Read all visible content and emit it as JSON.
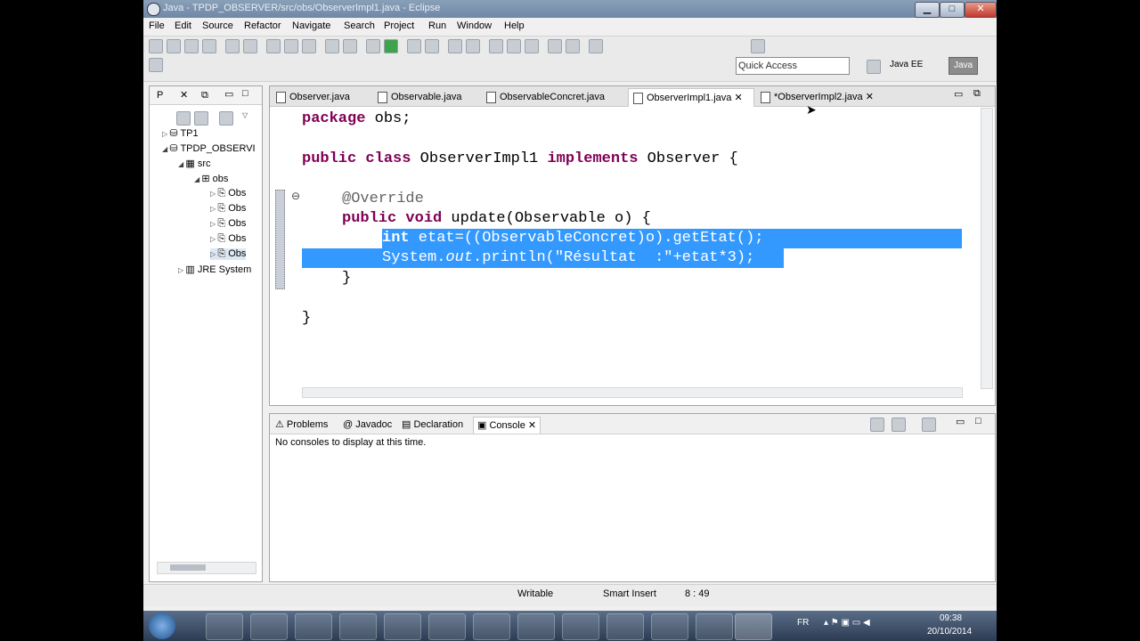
{
  "window": {
    "title": "Java - TPDP_OBSERVER/src/obs/ObserverImpl1.java - Eclipse",
    "controls": {
      "minimize": "▁",
      "maximize": "□",
      "close": "✕"
    }
  },
  "menu": [
    "File",
    "Edit",
    "Source",
    "Refactor",
    "Navigate",
    "Search",
    "Project",
    "Run",
    "Window",
    "Help"
  ],
  "quick_access": {
    "placeholder": "Quick Access"
  },
  "perspectives": [
    "Java EE",
    "Java"
  ],
  "package_explorer": {
    "tabs": [
      "P",
      "⧉"
    ],
    "tree": [
      {
        "label": "TP1"
      },
      {
        "label": "TPDP_OBSERVI"
      },
      {
        "label": "src"
      },
      {
        "label": "obs"
      },
      {
        "label": "Obs"
      },
      {
        "label": "Obs"
      },
      {
        "label": "Obs"
      },
      {
        "label": "Obs"
      },
      {
        "label": "Obs"
      },
      {
        "label": "JRE System"
      }
    ]
  },
  "editor": {
    "tabs": [
      {
        "label": "Observer.java",
        "active": false
      },
      {
        "label": "Observable.java",
        "active": false
      },
      {
        "label": "ObservableConcret.java",
        "active": false
      },
      {
        "label": "ObserverImpl1.java",
        "active": true
      },
      {
        "label": "*ObserverImpl2.java",
        "active": false
      }
    ],
    "close_glyph": "✕",
    "fold_glyph": "⊖",
    "code": {
      "l1_kw": "package",
      "l1_rest": " obs;",
      "l2_kw1": "public class",
      "l2_name": " ObserverImpl1 ",
      "l2_kw2": "implements",
      "l2_rest": " Observer {",
      "l3_ann": "@Override",
      "l4_kw": "public void",
      "l4_rest": " update(Observable o) {",
      "l5_kw": "int",
      "l5_rest": " etat=((ObservableConcret)o).getEtat();",
      "l6_a": "System.",
      "l6_b": "out",
      "l6_c": ".println(\"Résultat  :\"+etat*3);",
      "l7": "}",
      "l8": "}"
    }
  },
  "bottom_panel": {
    "tabs": [
      "Problems",
      "Javadoc",
      "Declaration",
      "Console"
    ],
    "message": "No consoles to display at this time."
  },
  "status": {
    "writable": "Writable",
    "insert": "Smart Insert",
    "position": "8 : 49"
  },
  "tray": {
    "lang": "FR",
    "time": "09:38",
    "date": "20/10/2014"
  },
  "colors": {
    "selection": "#3399ff",
    "keyword": "#7f0055",
    "annotation": "#646464"
  }
}
